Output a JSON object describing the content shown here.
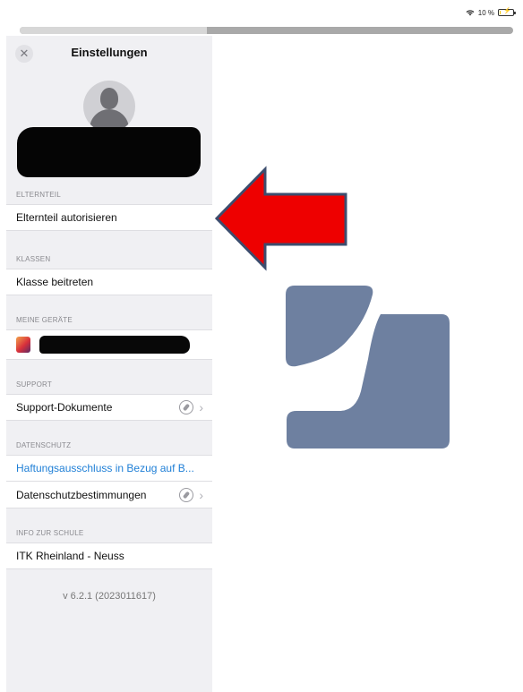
{
  "status": {
    "battery": "10 %",
    "battery_level": 0.1
  },
  "progress": {
    "fraction": 0.38
  },
  "header": {
    "close_icon": "close-icon",
    "title": "Einstellungen"
  },
  "sections": {
    "elternteil": {
      "header": "ELTERNTEIL",
      "row": "Elternteil autorisieren"
    },
    "klassen": {
      "header": "KLASSEN",
      "row": "Klasse beitreten"
    },
    "meine_geraete": {
      "header": "MEINE GERÄTE"
    },
    "support": {
      "header": "SUPPORT",
      "row": "Support-Dokumente"
    },
    "datenschutz": {
      "header": "DATENSCHUTZ",
      "row1": "Haftungsausschluss in Bezug auf B...",
      "row2": "Datenschutzbestimmungen"
    },
    "info_schule": {
      "header": "INFO ZUR SCHULE",
      "row": "ITK Rheinland - Neuss"
    }
  },
  "version": "v 6.2.1 (2023011617)",
  "colors": {
    "accent_link": "#1f7fd6",
    "logo": "#6e80a0",
    "arrow_fill": "#ee0000",
    "arrow_stroke": "#3c4d6e"
  }
}
